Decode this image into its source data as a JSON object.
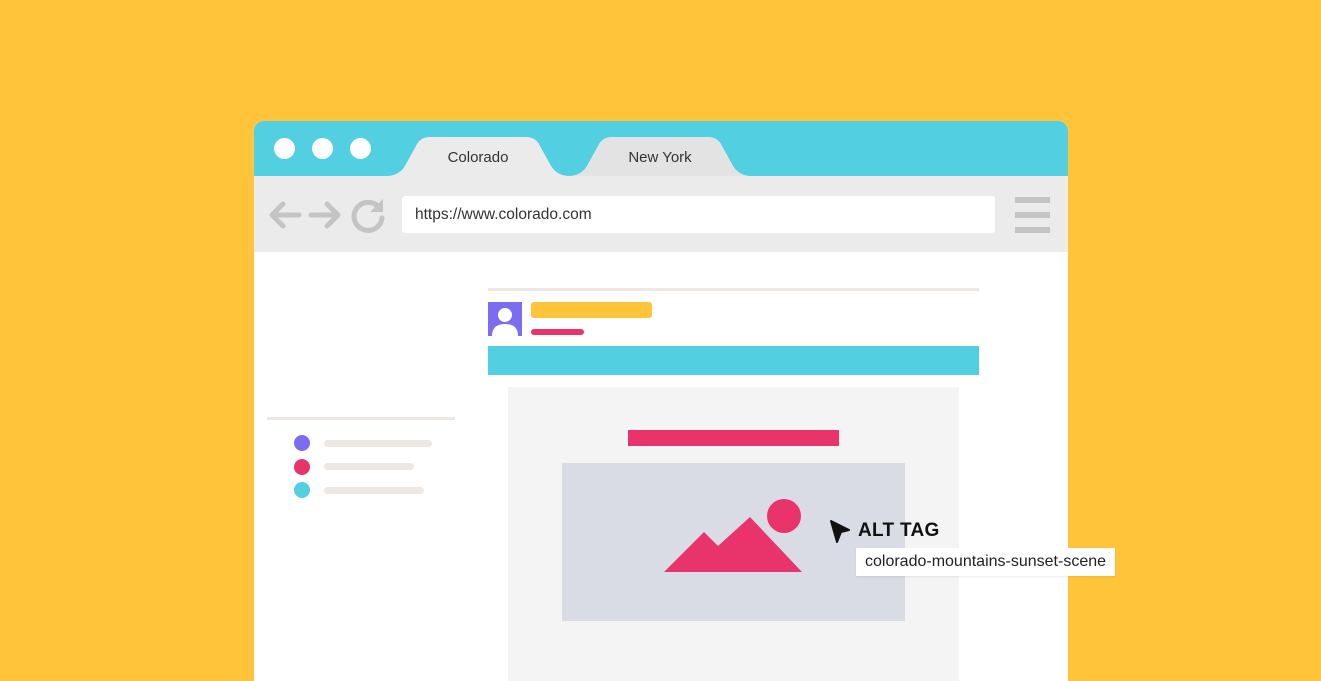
{
  "browser": {
    "tabs": [
      {
        "label": "Colorado",
        "active": true
      },
      {
        "label": "New York",
        "active": false
      }
    ],
    "url": "https://www.colorado.com",
    "icons": [
      "back-arrow-icon",
      "forward-arrow-icon",
      "reload-icon",
      "hamburger-menu-icon"
    ]
  },
  "annotation": {
    "label": "ALT TAG",
    "alt_text": "colorado-mountains-sunset-scene",
    "cursor_icon": "arrow-cursor-icon"
  },
  "colors": {
    "background": "#FFC43A",
    "titlebar": "#52D0E2",
    "toolbar": "#EBEBEB",
    "purple": "#7B6CF0",
    "pink": "#E8336B",
    "cyan": "#52D0E2",
    "yellow": "#FFC43A",
    "image_bg": "#D9DBE5"
  }
}
